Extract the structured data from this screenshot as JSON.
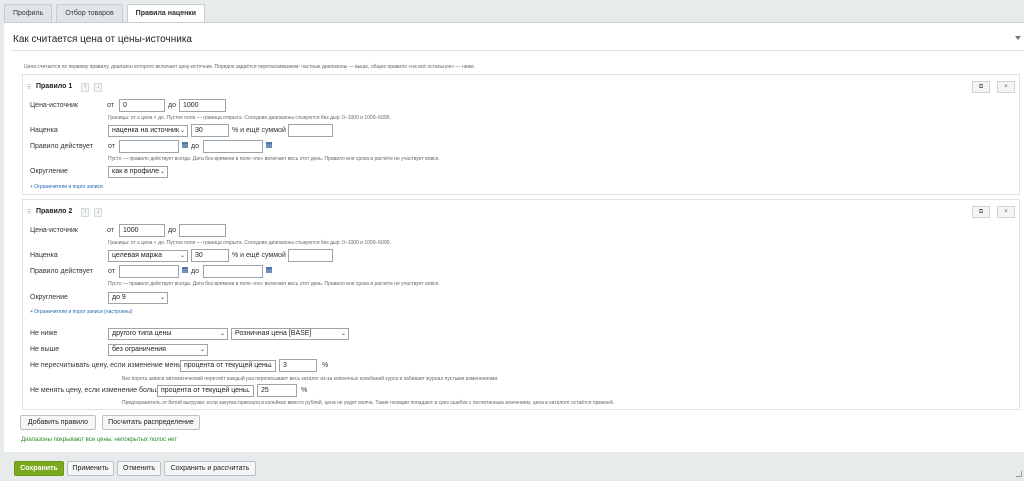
{
  "tabs": [
    {
      "label": "Профиль"
    },
    {
      "label": "Отбор товаров"
    },
    {
      "label": "Правила наценки"
    }
  ],
  "title": "Как считается цена от цены-источника",
  "intro": "Цена считается по первому правилу, диапазон которого включает цену-источник. Порядок задаётся перетаскиванием: частные диапазоны — выше, общее правило «на всё остальное» — ниже.",
  "rules": [
    {
      "title": "Правило 1",
      "source_label": "Цена-источник",
      "from_label": "от",
      "to_label": "до",
      "from_value": "0",
      "to_value": "1000",
      "source_hint": "Границы: от ≤ цена < до. Пустое поле — граница открыта. Соседние диапазоны стыкуются без дыр: 0–1000 и 1000–5000.",
      "markup_label": "Наценка",
      "markup_type": "наценка на источник",
      "markup_value": "30",
      "markup_unit": "% и ещё суммой",
      "markup_sum": "",
      "period_label": "Правило действует",
      "period_from": "",
      "period_to": "",
      "period_hint": "Пусто — правило действует всегда. Дата без времени в поле «по» включает весь этот день. Правило вне срока в расчёте не участвует вовсе.",
      "round_label": "Округление",
      "round_value": "как в профиле",
      "limits_link": "+ Ограничители и порог записи"
    },
    {
      "title": "Правило 2",
      "source_label": "Цена-источник",
      "from_label": "от",
      "to_label": "до",
      "from_value": "1000",
      "to_value": "",
      "source_hint": "Границы: от ≤ цена < до. Пустое поле — граница открыта. Соседние диапазоны стыкуются без дыр: 0–1000 и 1000–5000.",
      "markup_label": "Наценка",
      "markup_type": "целевая маржа",
      "markup_value": "30",
      "markup_unit": "% и ещё суммой",
      "markup_sum": "",
      "period_label": "Правило действует",
      "period_from": "",
      "period_to": "",
      "period_hint": "Пусто — правило действует всегда. Дата без времени в поле «по» включает весь этот день. Правило вне срока в расчёте не участвует вовсе.",
      "round_label": "Округление",
      "round_value": "до 9",
      "limits_link": "+ Ограничители и порог записи (настроены)"
    }
  ],
  "limits": {
    "min_label": "Не ниже",
    "min_type": "другого типа цены",
    "min_price": "Розничная цена [BASE]",
    "max_label": "Не выше",
    "max_value": "без ограничения",
    "recalc_label": "Не пересчитывать цену, если изменение меньше",
    "recalc_mode": "процента от текущей цены",
    "recalc_value": "3",
    "recalc_unit": "%",
    "recalc_hint": "Без порога записи автоматический пересчёт каждый раз переписывает весь каталог из-за копеечных колебаний курса и забивает журнал пустыми изменениями.",
    "guard_label": "Не менять цену, если изменение больше",
    "guard_mode": "процента от текущей цены",
    "guard_value": "25",
    "guard_unit": "%",
    "guard_hint": "Предохранитель от битой выгрузки: если закупка приехала в копейках вместо рублей, цена не уедет молча. Такие позиции попадают в срез ошибок с посчитанным значением, цена в каталоге остаётся прежней."
  },
  "buttons": {
    "add_rule": "Добавить правило",
    "calc_dist": "Посчитать распределение"
  },
  "coverage_msg": "Диапазоны покрывают все цены, непокрытых полос нет",
  "footer": {
    "save": "Сохранить",
    "apply": "Применить",
    "cancel": "Отменить",
    "save_calc": "Сохранить и рассчитать"
  },
  "colors": {
    "save": "#7aa81f",
    "link": "#2067b0",
    "ok": "#2b8a2b"
  }
}
